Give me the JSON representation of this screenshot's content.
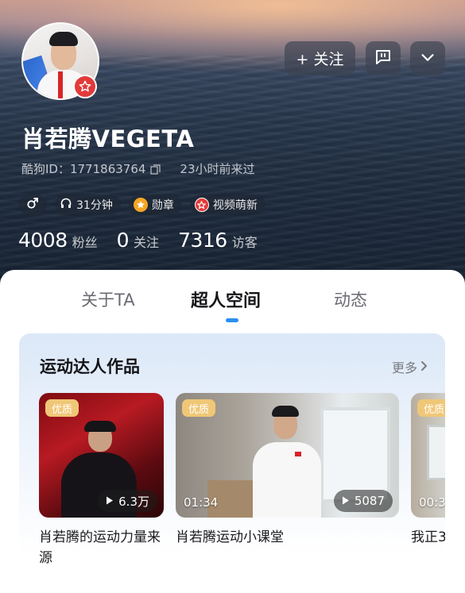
{
  "profile": {
    "name": "肖若腾VEGETA",
    "id_label": "酷狗ID：1771863764",
    "last_seen": "23小时前来过",
    "tags": [
      {
        "label": "♂",
        "icon": "male-icon"
      },
      {
        "label": "31分钟",
        "icon": "headphones-icon"
      },
      {
        "label": "勋章",
        "icon": "medal-icon",
        "color": "#f5a623"
      },
      {
        "label": "视频萌新",
        "icon": "video-badge-icon",
        "color": "#e23a3a"
      }
    ],
    "stats": [
      {
        "value": "4008",
        "label": "粉丝"
      },
      {
        "value": "0",
        "label": "关注"
      },
      {
        "value": "7316",
        "label": "访客"
      }
    ]
  },
  "actions": {
    "follow_label": "+ 关注",
    "message_icon": "chat-icon",
    "more_icon": "chevron-down-icon"
  },
  "tabs": [
    {
      "label": "关于TA",
      "active": false
    },
    {
      "label": "超人空间",
      "active": true
    },
    {
      "label": "动态",
      "active": false
    }
  ],
  "section": {
    "title": "运动达人作品",
    "more_label": "更多"
  },
  "videos": [
    {
      "badge": "优质",
      "duration": "",
      "plays": "6.3万",
      "title": "肖若腾的运动力量来源"
    },
    {
      "badge": "优质",
      "duration": "01:34",
      "plays": "5087",
      "title": "肖若腾运动小课堂"
    },
    {
      "badge": "优质",
      "duration": "00:3",
      "plays": "",
      "title": "我正3"
    }
  ],
  "colors": {
    "accent": "#2b8ff0",
    "badge": "#f0c777",
    "avatar_badge": "#e23a3a"
  }
}
